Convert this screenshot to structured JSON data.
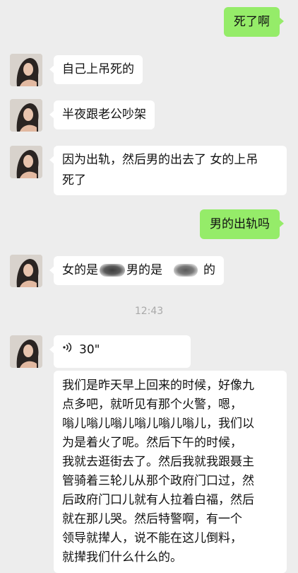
{
  "messages": [
    {
      "side": "right",
      "text": "死了啊"
    },
    {
      "side": "left",
      "text": "自己上吊死的"
    },
    {
      "side": "left",
      "text": "半夜跟老公吵架"
    },
    {
      "side": "left",
      "line1": "因为出轨，然后男的出去了 女的上吊",
      "line2": "死了"
    },
    {
      "side": "right",
      "text": "男的出轨吗"
    },
    {
      "side": "left",
      "part1": "女的是",
      "part2": "男的是",
      "part3": "的"
    },
    {
      "timestamp": "12:43"
    },
    {
      "side": "left",
      "voice_duration": "30\""
    },
    {
      "side": "left",
      "lines": [
        "我们是昨天早上回来的时候，好像九",
        "点多吧，就听见有那个火警，嗯，",
        "嗡儿嗡儿嗡儿嗡儿嗡儿嗡儿，我们以",
        "为是着火了呢。然后下午的时候，",
        "我就去逛街去了。然后我就我跟聂主",
        "管骑着三轮儿从那个政府门口过，然",
        "后政府门口儿就有人拉着白福，然后",
        "就在那儿哭。然后特警啊，有一个",
        "领导就撵人，说不能在这儿倒料，",
        "就撵我们什么什么的。"
      ]
    }
  ],
  "colors": {
    "background": "#ededed",
    "bubble_self": "#95ec69",
    "bubble_other": "#ffffff",
    "timestamp": "#a9a9a9"
  },
  "icons": [
    "avatar-photo",
    "voice-wave-icon",
    "redaction-blur"
  ]
}
